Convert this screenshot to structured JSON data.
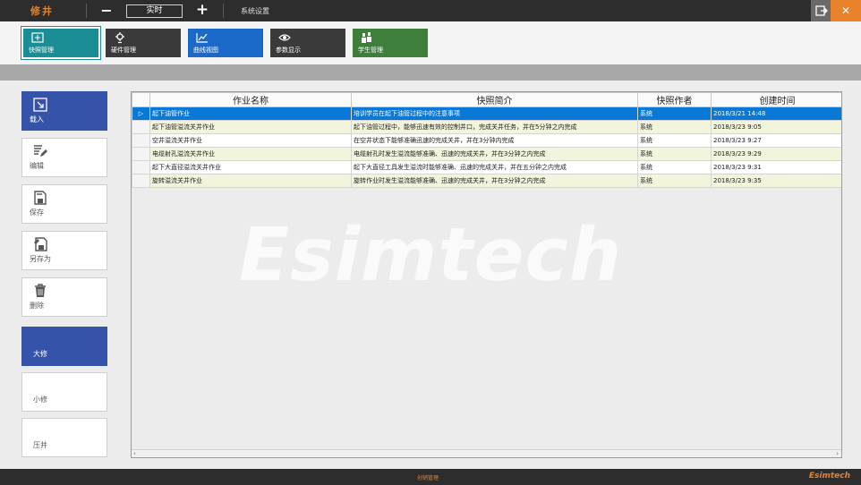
{
  "topbar": {
    "app_title": "修井",
    "mode_label": "实时",
    "settings_label": "系统设置",
    "close_label": "✕",
    "accent": "#e8822b"
  },
  "modules": [
    {
      "label": "快照管理",
      "color": "#1b8d95",
      "icon": "snapshot-icon"
    },
    {
      "label": "硬件管理",
      "color": "#3a3a3a",
      "icon": "hardware-icon"
    },
    {
      "label": "曲线视图",
      "color": "#1b6ac9",
      "icon": "chart-line-icon"
    },
    {
      "label": "参数显示",
      "color": "#3a3a3a",
      "icon": "eye-icon"
    },
    {
      "label": "学生管理",
      "color": "#3f7f3c",
      "icon": "students-icon"
    }
  ],
  "side_actions": [
    {
      "label": "载入",
      "icon": "load-icon"
    },
    {
      "label": "编辑",
      "icon": "edit-icon"
    },
    {
      "label": "保存",
      "icon": "save-icon"
    },
    {
      "label": "另存为",
      "icon": "save-as-icon"
    },
    {
      "label": "删除",
      "icon": "delete-icon"
    }
  ],
  "repair_modes": [
    "大修",
    "小修",
    "压井"
  ],
  "selected_mode": "大修",
  "table": {
    "columns": [
      "作业名称",
      "快照简介",
      "快照作者",
      "创建时间"
    ],
    "rows": [
      [
        "起下油管作业",
        "培训学员在起下油管过程中的注意事项",
        "系统",
        "2018/3/21 14:48"
      ],
      [
        "起下油管溢流关井作业",
        "起下油管过程中，能够迅速有效的控制井口，完成关井任务，并在5分钟之内完成",
        "系统",
        "2018/3/23 9:05"
      ],
      [
        "空井溢流关井作业",
        "在空井状态下能够准确迅速的完成关井，并在3分钟内完成",
        "系统",
        "2018/3/23 9:27"
      ],
      [
        "电缆射孔溢流关井作业",
        "电缆射孔时发生溢流能够准确、迅速的完成关井，并在3分钟之内完成",
        "系统",
        "2018/3/23 9:29"
      ],
      [
        "起下大直径溢流关井作业",
        "起下大直径工具发生溢流时能够准确、迅速的完成关井，并在五分钟之内完成",
        "系统",
        "2018/3/23 9:31"
      ],
      [
        "旋转溢流关井作业",
        "旋转作业时发生溢流能够准确、迅速的完成关井，并在3分钟之内完成",
        "系统",
        "2018/3/23 9:35"
      ]
    ],
    "selected_row": 0,
    "row_indicator": "▷"
  },
  "watermark": "Esimtech",
  "footer": {
    "center_text": "创销管理",
    "brand": "Esimtech"
  }
}
